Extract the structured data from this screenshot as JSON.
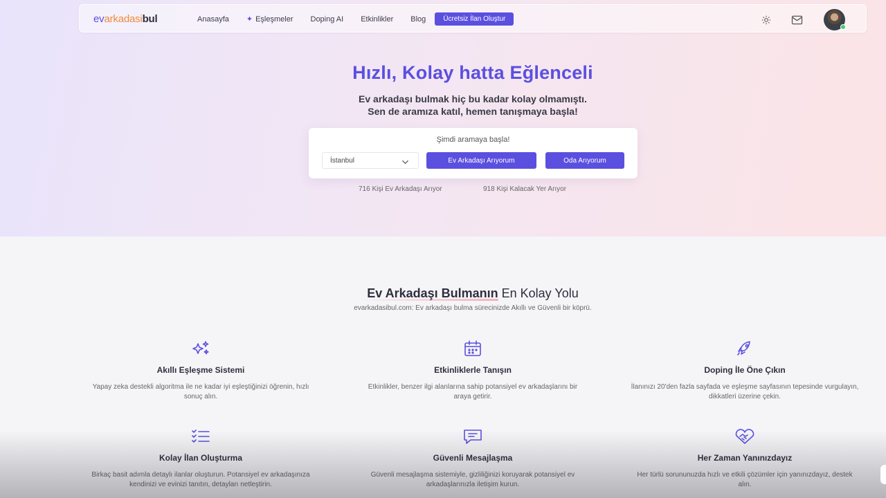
{
  "colors": {
    "accent": "#5b4fe0",
    "logo_orange": "#f08a3c"
  },
  "nav": {
    "logo": {
      "part1": "ev",
      "part2": "arkadasi",
      "part3": "bul"
    },
    "links": [
      {
        "label": "Anasayfa",
        "icon": ""
      },
      {
        "label": "Eşleşmeler",
        "icon": "sparkle-icon"
      },
      {
        "label": "Doping AI",
        "icon": ""
      },
      {
        "label": "Etkinlikler",
        "icon": ""
      },
      {
        "label": "Blog",
        "icon": ""
      }
    ],
    "cta": "Ücretsiz İlan Oluştur",
    "right_icons": [
      "sun-icon",
      "mail-icon",
      "avatar"
    ]
  },
  "hero": {
    "title": "Hızlı, Kolay hatta Eğlenceli",
    "subtitle_line1": "Ev arkadaşı bulmak hiç bu kadar kolay olmamıştı.",
    "subtitle_line2": "Sen de aramıza katıl, hemen tanışmaya başla!"
  },
  "search": {
    "title": "Şimdi aramaya başla!",
    "city": "İstanbul",
    "btn_roommate": "Ev Arkadaşı Arıyorum",
    "btn_room": "Oda Arıyorum",
    "stat1": "716 Kişi Ev Arkadaşı Arıyor",
    "stat2": "918 Kişi Kalacak Yer Arıyor"
  },
  "section": {
    "title_highlight": "Ev Arkadaşı Bulmanın",
    "title_rest": " En Kolay Yolu",
    "subtitle": "evarkadasibul.com: Ev arkadaşı bulma sürecinizde Akıllı ve Güvenli bir köprü."
  },
  "features": [
    {
      "icon": "sparkles-icon",
      "title": "Akıllı Eşleşme Sistemi",
      "desc": "Yapay zeka destekli algoritma ile ne kadar iyi eşleştiğinizi öğrenin, hızlı sonuç alın."
    },
    {
      "icon": "calendar-icon",
      "title": "Etkinliklerle Tanışın",
      "desc": "Etkinlikler, benzer ilgi alanlarına sahip potansiyel ev arkadaşlarını bir araya getirir."
    },
    {
      "icon": "rocket-icon",
      "title": "Doping İle Öne Çıkın",
      "desc": "İlanınızı 20'den fazla sayfada ve eşleşme sayfasının tepesinde vurgulayın, dikkatleri üzerine çekin."
    },
    {
      "icon": "list-check-icon",
      "title": "Kolay İlan Oluşturma",
      "desc": "Birkaç basit adımla detaylı ilanlar oluşturun. Potansiyel ev arkadaşınıza kendinizi ve evinizi tanıtın, detayları netleştirin."
    },
    {
      "icon": "message-icon",
      "title": "Güvenli Mesajlaşma",
      "desc": "Güvenli mesajlaşma sistemiyle, gizliliğinizi koruyarak potansiyel ev arkadaşlarınızla iletişim kurun."
    },
    {
      "icon": "heart-handshake-icon",
      "title": "Her Zaman Yanınızdayız",
      "desc": "Her türlü sorununuzda hızlı ve etkili çözümler için yanınızdayız, destek alın."
    }
  ]
}
